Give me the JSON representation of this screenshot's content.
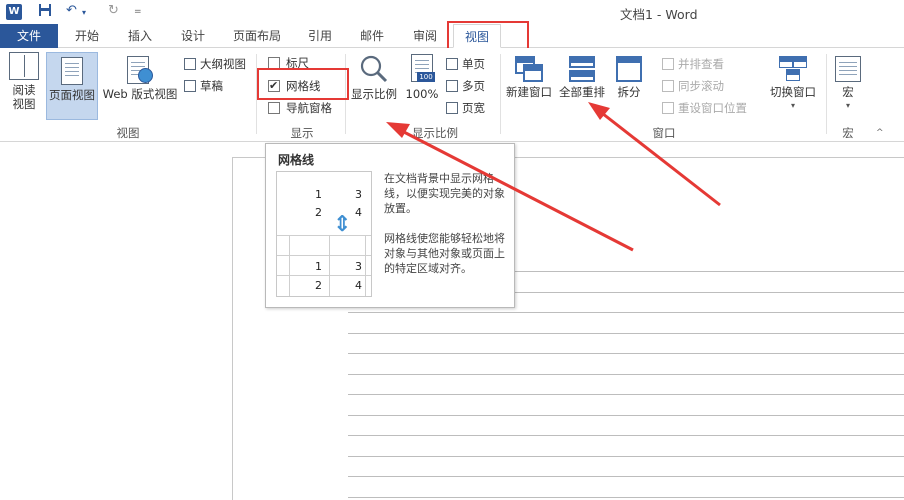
{
  "titlebar": {
    "app_icon": "W",
    "save_icon": "save-icon",
    "undo_icon": "↶",
    "redo_icon": "↻",
    "customize_icon": "=",
    "title": "文档1 - Word"
  },
  "tabs": [
    "文件",
    "开始",
    "插入",
    "设计",
    "页面布局",
    "引用",
    "邮件",
    "审阅",
    "视图"
  ],
  "ribbon": {
    "views": {
      "read_mode": "阅读\n视图",
      "print_layout": "页面视图",
      "web_layout": "Web 版式视图",
      "outline": "大纲视图",
      "draft": "草稿",
      "group_label": "视图"
    },
    "show": {
      "ruler": "标尺",
      "gridlines": "网格线",
      "nav_pane": "导航窗格",
      "group_label": "显示"
    },
    "zoom": {
      "zoom": "显示比例",
      "hundred": "100%",
      "one_page": "单页",
      "multi_page": "多页",
      "page_width": "页宽",
      "group_label": "显示比例"
    },
    "window": {
      "new_window": "新建窗口",
      "arrange_all": "全部重排",
      "split": "拆分",
      "side_by_side": "并排查看",
      "sync_scroll": "同步滚动",
      "reset_position": "重设窗口位置",
      "switch_windows": "切换窗口",
      "group_label": "窗口"
    },
    "macros": {
      "macros": "宏",
      "group_label": "宏"
    }
  },
  "tooltip": {
    "title": "网格线",
    "preview_numbers": [
      "1",
      "3",
      "2",
      "4",
      "1",
      "3",
      "2",
      "4"
    ],
    "desc1": "在文档背景中显示网格线，以便实现完美的对象放置。",
    "desc2": "网格线使您能够轻松地将对象与其他对象或页面上的特定区域对齐。"
  },
  "colors": {
    "accent": "#2b579a",
    "highlight": "#e53935"
  }
}
